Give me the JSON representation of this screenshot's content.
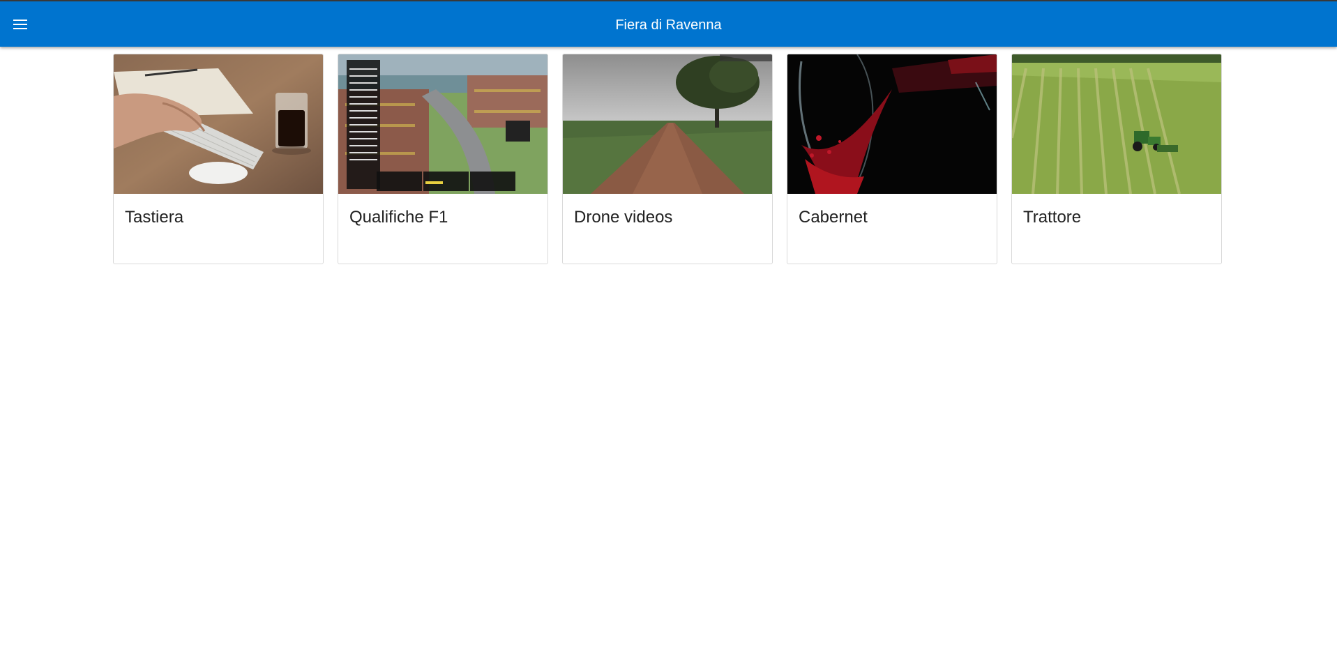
{
  "appbar": {
    "title": "Fiera di Ravenna",
    "menu_icon": "hamburger-menu-icon",
    "color": "#0074cf"
  },
  "cards": [
    {
      "title": "Tastiera",
      "thumbnail": "keyboard-and-coffee-thumbnail"
    },
    {
      "title": "Qualifiche F1",
      "thumbnail": "f1-qualifying-thumbnail"
    },
    {
      "title": "Drone videos",
      "thumbnail": "dirt-road-drone-thumbnail"
    },
    {
      "title": "Cabernet",
      "thumbnail": "red-wine-pour-thumbnail"
    },
    {
      "title": "Trattore",
      "thumbnail": "tractor-field-thumbnail"
    }
  ]
}
